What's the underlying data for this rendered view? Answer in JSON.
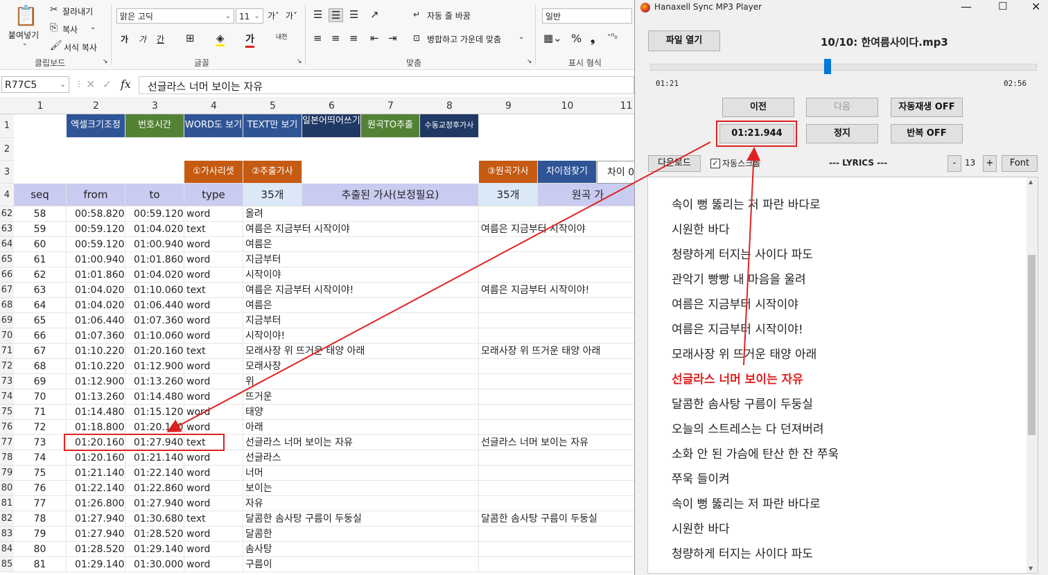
{
  "ribbon": {
    "paste": "붙여넣기",
    "cut": "잘라내기",
    "copy": "복사",
    "format_painter": "서식 복사",
    "font_name": "맑은 고딕",
    "font_size": "11",
    "wrap_text": "자동 줄 바꿈",
    "merge_center": "병합하고 가운데 맞춤",
    "number_format": "일반",
    "group_clipboard": "클립보드",
    "group_font": "글꼴",
    "group_align": "맞춤",
    "group_number": "표시 형식"
  },
  "formula_bar": {
    "name_box": "R77C5",
    "fx": "fx",
    "content": "선글라스 너머 보이는 자유"
  },
  "sheet": {
    "col_headers": [
      "1",
      "2",
      "3",
      "4",
      "5",
      "6",
      "7",
      "8",
      "9",
      "10",
      "11"
    ],
    "row1": {
      "b2": "엑셀크기조정",
      "b3": "번호시간",
      "b4": "WORD도 보기",
      "b5": "TEXT만 보기",
      "b6": "일본어띄어쓰기",
      "b7": "원곡TO추출",
      "b8": "수동교정후가사"
    },
    "row3": {
      "c4": "①가사리셋",
      "c5": "②추출가사",
      "c9": "③원곡가사",
      "c10": "차이점찾기",
      "c11": "차이 0"
    },
    "row4": {
      "h1": "seq",
      "h2": "from",
      "h3": "to",
      "h4": "type",
      "h5": "35개",
      "h6": "추출된 가사(보정필요)",
      "h9": "35개",
      "h10": "원곡 가"
    },
    "rows": [
      {
        "r": "62",
        "seq": "58",
        "from": "00:58.820",
        "to": "00:59.120",
        "type": "word",
        "lyric": "올려",
        "orig": ""
      },
      {
        "r": "63",
        "seq": "59",
        "from": "00:59.120",
        "to": "01:04.020",
        "type": "text",
        "lyric": "여름은 지금부터 시작이야",
        "orig": "여름은 지금부터 시작이야"
      },
      {
        "r": "64",
        "seq": "60",
        "from": "00:59.120",
        "to": "01:00.940",
        "type": "word",
        "lyric": "여름은",
        "orig": ""
      },
      {
        "r": "65",
        "seq": "61",
        "from": "01:00.940",
        "to": "01:01.860",
        "type": "word",
        "lyric": "지금부터",
        "orig": ""
      },
      {
        "r": "66",
        "seq": "62",
        "from": "01:01.860",
        "to": "01:04.020",
        "type": "word",
        "lyric": "시작이야",
        "orig": ""
      },
      {
        "r": "67",
        "seq": "63",
        "from": "01:04.020",
        "to": "01:10.060",
        "type": "text",
        "lyric": "여름은 지금부터 시작이야!",
        "orig": "여름은 지금부터 시작이야!"
      },
      {
        "r": "68",
        "seq": "64",
        "from": "01:04.020",
        "to": "01:06.440",
        "type": "word",
        "lyric": "여름은",
        "orig": ""
      },
      {
        "r": "69",
        "seq": "65",
        "from": "01:06.440",
        "to": "01:07.360",
        "type": "word",
        "lyric": "지금부터",
        "orig": ""
      },
      {
        "r": "70",
        "seq": "66",
        "from": "01:07.360",
        "to": "01:10.060",
        "type": "word",
        "lyric": "시작이야!",
        "orig": ""
      },
      {
        "r": "71",
        "seq": "67",
        "from": "01:10.220",
        "to": "01:20.160",
        "type": "text",
        "lyric": "모래사장 위 뜨거운 태양 아래",
        "orig": "모래사장 위 뜨거운 태양 아래"
      },
      {
        "r": "72",
        "seq": "68",
        "from": "01:10.220",
        "to": "01:12.900",
        "type": "word",
        "lyric": "모래사장",
        "orig": ""
      },
      {
        "r": "73",
        "seq": "69",
        "from": "01:12.900",
        "to": "01:13.260",
        "type": "word",
        "lyric": "위",
        "orig": ""
      },
      {
        "r": "74",
        "seq": "70",
        "from": "01:13.260",
        "to": "01:14.480",
        "type": "word",
        "lyric": "뜨거운",
        "orig": ""
      },
      {
        "r": "75",
        "seq": "71",
        "from": "01:14.480",
        "to": "01:15.120",
        "type": "word",
        "lyric": "태양",
        "orig": ""
      },
      {
        "r": "76",
        "seq": "72",
        "from": "01:18.800",
        "to": "01:20.160",
        "type": "word",
        "lyric": "아래",
        "orig": ""
      },
      {
        "r": "77",
        "seq": "73",
        "from": "01:20.160",
        "to": "01:27.940",
        "type": "text",
        "lyric": "선글라스 너머 보이는 자유",
        "orig": "선글라스 너머 보이는 자유"
      },
      {
        "r": "78",
        "seq": "74",
        "from": "01:20.160",
        "to": "01:21.140",
        "type": "word",
        "lyric": "선글라스",
        "orig": ""
      },
      {
        "r": "79",
        "seq": "75",
        "from": "01:21.140",
        "to": "01:22.140",
        "type": "word",
        "lyric": "너머",
        "orig": ""
      },
      {
        "r": "80",
        "seq": "76",
        "from": "01:22.140",
        "to": "01:22.860",
        "type": "word",
        "lyric": "보이는",
        "orig": ""
      },
      {
        "r": "81",
        "seq": "77",
        "from": "01:26.800",
        "to": "01:27.940",
        "type": "word",
        "lyric": "자유",
        "orig": ""
      },
      {
        "r": "82",
        "seq": "78",
        "from": "01:27.940",
        "to": "01:30.680",
        "type": "text",
        "lyric": "달콤한 솜사탕 구름이 두둥실",
        "orig": "달콤한 솜사탕 구름이 두둥실"
      },
      {
        "r": "83",
        "seq": "79",
        "from": "01:27.940",
        "to": "01:28.520",
        "type": "word",
        "lyric": "달콤한",
        "orig": ""
      },
      {
        "r": "84",
        "seq": "80",
        "from": "01:28.520",
        "to": "01:29.140",
        "type": "word",
        "lyric": "솜사탕",
        "orig": ""
      },
      {
        "r": "85",
        "seq": "81",
        "from": "01:29.140",
        "to": "01:30.000",
        "type": "word",
        "lyric": "구름이",
        "orig": ""
      }
    ]
  },
  "player": {
    "title": "Hanaxell Sync MP3 Player",
    "open_file": "파일 열기",
    "track": "10/10: 한여름사이다.mp3",
    "elapsed": "01:21",
    "total": "02:56",
    "progress": 0.46,
    "prev": "이전",
    "next": "다음",
    "autoplay": "자동재생 OFF",
    "timestamp": "01:21.944",
    "stop": "정지",
    "repeat": "반복 OFF",
    "download": "다운로드",
    "autoscroll": "자동스크롤",
    "lyrics_label": "--- LYRICS ---",
    "minus": "-",
    "font_size": "13",
    "plus": "+",
    "font_btn": "Font",
    "lyrics": [
      "속이 뻥 뚫리는 저 파란 바다로",
      "시원한 바다",
      "청량하게 터지는 사이다 파도",
      "관악기 빵빵 내 마음을 울려",
      "여름은 지금부터 시작이야",
      "여름은 지금부터 시작이야!",
      "모래사장 위 뜨거운 태양 아래",
      "선글라스 너머 보이는 자유",
      "달콤한 솜사탕 구름이 두둥실",
      "오늘의 스트레스는 다 던져버려",
      "소화 안 된 가슴에 탄산 한 잔 쭈욱",
      "쭈욱 들이켜",
      "속이 뻥 뚫리는 저 파란 바다로",
      "시원한 바다",
      "청량하게 터지는 사이다 파도"
    ],
    "active_lyric_index": 7
  },
  "colors": {
    "highlight_red": "#e02020",
    "header_blue": "#2f5597",
    "header_green": "#548235",
    "header_navy": "#203864",
    "header_orange": "#c55a11",
    "header_lavender": "#c9cbf1",
    "header_lightblue": "#dbe8f7"
  }
}
